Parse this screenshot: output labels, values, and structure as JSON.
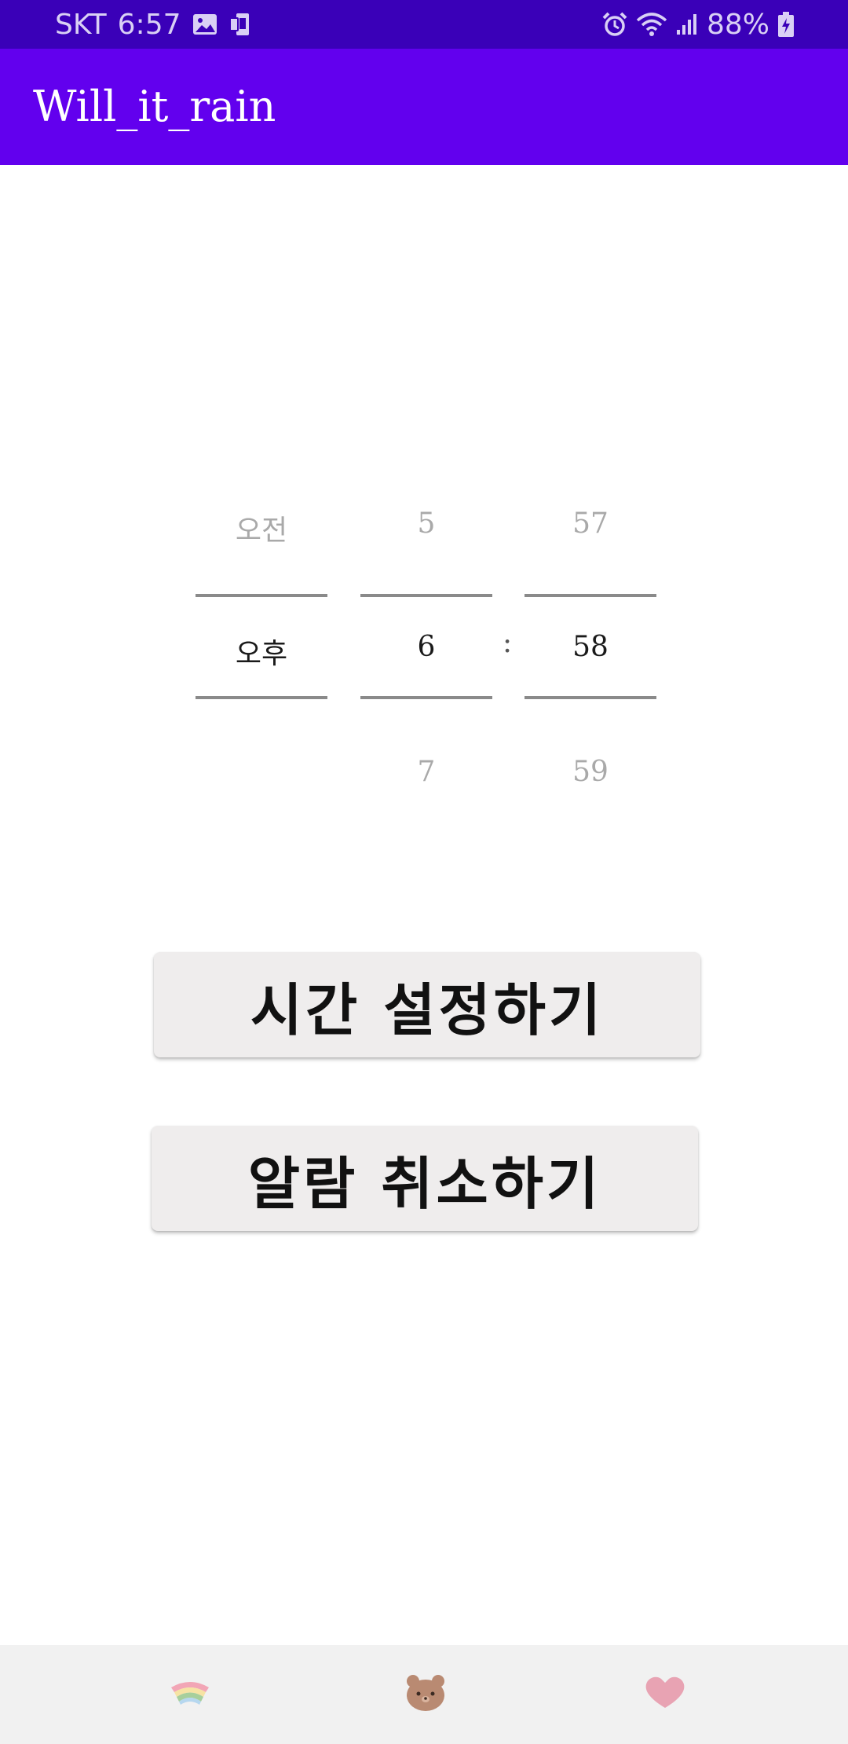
{
  "status_bar": {
    "carrier": "SKT",
    "time": "6:57",
    "battery": "88%",
    "icons": [
      "image-icon",
      "phone-screen-icon",
      "alarm-icon",
      "wifi-icon",
      "signal-icon",
      "battery-charging-icon"
    ]
  },
  "app_bar": {
    "title": "Will_it_rain"
  },
  "time_picker": {
    "ampm": {
      "above": "오전",
      "selected": "오후",
      "below": ""
    },
    "hour": {
      "above": "5",
      "selected": "6",
      "below": "7"
    },
    "separator": ":",
    "minute": {
      "above": "57",
      "selected": "58",
      "below": "59"
    }
  },
  "buttons": {
    "set_time": "시간 설정하기",
    "cancel_alarm": "알람 취소하기"
  },
  "bottom_nav": {
    "items": [
      {
        "icon": "rainbow-icon",
        "color": "#f0a3b4"
      },
      {
        "icon": "bear-icon",
        "color": "#b98a72"
      },
      {
        "icon": "heart-icon",
        "color": "#e8a3b3"
      }
    ]
  },
  "colors": {
    "status_bar": "#3a00b8",
    "app_bar": "#6200ee",
    "button_bg": "#efeded",
    "nav_bg": "#f1f1f1"
  }
}
